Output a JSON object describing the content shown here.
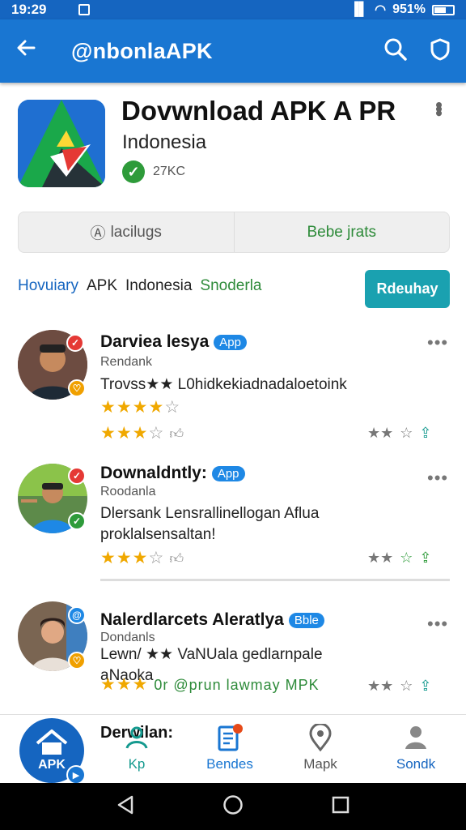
{
  "status_bar": {
    "time": "19:29",
    "icons": "ℝᛋ .ıl",
    "battery_text": "951%"
  },
  "app_bar": {
    "title": "@nbonlaAPK",
    "back_icon": "arrow-left-icon",
    "actions": [
      "search-icon",
      "shield-icon"
    ]
  },
  "app": {
    "title": "Dovwnload APK A PR",
    "subtitle": "Indonesia",
    "meta": "27KC",
    "verified_icon": "check-circle-icon"
  },
  "segment": {
    "left_label": "lacilugs",
    "right_label": "Bebe jrats"
  },
  "tags": {
    "t1": "Hovuiary",
    "t2": "APK",
    "t3": "Indonesia",
    "t4": "Snoderla"
  },
  "action_button": {
    "label": "Rdeuhay"
  },
  "reviews": [
    {
      "name": "Darviea lesya",
      "pill": "App",
      "sub": "Rendank",
      "text": "Trovss★★ L0hidkekiadnadaloetoink",
      "rating": 3.5,
      "colors": {
        "bg": "#8a4a3a"
      }
    },
    {
      "name": "Downaldntly:",
      "pill": "App",
      "sub": "Roodanla",
      "text": "Dlersank Lensrallinellogan Aflua proklalsensaltan!",
      "rating": 3.5,
      "colors": {
        "bg": "#4a7a3a"
      }
    },
    {
      "name": "Nalerdlarcets Aleratlya",
      "pill": "Bble",
      "sub": "Dondanls",
      "text": "Lewn/ ★★ VaNUala gedlarnpale aNaoka",
      "rating": 3,
      "footer": "0r @prun lawmay MPK",
      "colors": {
        "bg": "#6a5a4a"
      }
    }
  ],
  "bottom_nav": {
    "fab_label": "APK",
    "heading": "Derwilan:",
    "items": [
      {
        "label": "Kp",
        "icon": "person-icon"
      },
      {
        "label": "Bendes",
        "icon": "document-icon"
      },
      {
        "label": "Mapk",
        "icon": "map-pin-icon"
      },
      {
        "label": "Sondk",
        "icon": "account-icon"
      }
    ]
  },
  "system_nav": [
    "back-triangle-icon",
    "home-circle-icon",
    "recents-square-icon"
  ]
}
